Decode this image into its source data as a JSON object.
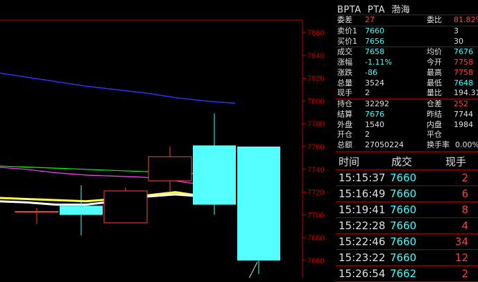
{
  "header": {
    "code": "BPTA",
    "name": "PTA",
    "exchange": "渤海"
  },
  "quote": {
    "weicha_label": "委差",
    "weicha": "27",
    "weibi_label": "委比",
    "weibi": "81.82%",
    "sell1_label": "卖价1",
    "sell1_price": "7660",
    "sell1_vol": "3",
    "buy1_label": "买价1",
    "buy1_price": "7656",
    "buy1_vol": "30",
    "last_label": "成交",
    "last": "7658",
    "avg_label": "均价",
    "avg": "7676",
    "chgpct_label": "涨幅",
    "chgpct": "-1.11%",
    "open_label": "今开",
    "open": "7758",
    "chg_label": "涨跌",
    "chg": "-86",
    "high_label": "最高",
    "high": "7758",
    "vol_label": "总量",
    "vol": "3524",
    "low_label": "最低",
    "low": "7648",
    "curvol_label": "现手",
    "curvol": "2",
    "volratio_label": "量比",
    "volratio": "194.31",
    "oi_label": "持仓",
    "oi": "32292",
    "oichg_label": "仓差",
    "oichg": "252",
    "settle_label": "结算",
    "settle": "7676",
    "presettle_label": "昨结",
    "presettle": "7744",
    "outer_label": "外盘",
    "outer": "1540",
    "inner_label": "内盘",
    "inner": "1984",
    "openpos_label": "开仓",
    "openpos": "2",
    "closepos_label": "平仓",
    "closepos": "",
    "amount_label": "总额",
    "amount": "27050224",
    "turnover_label": "换手率",
    "turnover": "0.00%"
  },
  "ticks": {
    "headers": {
      "time": "时间",
      "price": "成交",
      "vol": "现手"
    },
    "rows": [
      {
        "time": "15:15:37",
        "price": "7660",
        "vol": "2"
      },
      {
        "time": "15:16:49",
        "price": "7660",
        "vol": "6"
      },
      {
        "time": "15:19:41",
        "price": "7660",
        "vol": "8"
      },
      {
        "time": "15:22:28",
        "price": "7660",
        "vol": "4"
      },
      {
        "time": "15:22:46",
        "price": "7660",
        "vol": "34"
      },
      {
        "time": "15:23:22",
        "price": "7660",
        "vol": "12"
      },
      {
        "time": "15:26:54",
        "price": "7662",
        "vol": "2"
      }
    ]
  },
  "chart_data": {
    "type": "candlestick",
    "y_ticks": [
      "7860",
      "7840",
      "7820",
      "7800",
      "7780",
      "7760",
      "7740",
      "7720",
      "7700",
      "7680",
      "7660"
    ],
    "low_label": "7648",
    "colors": {
      "up": "#ff4040",
      "down": "#54ffff",
      "ma1": "#ffffff",
      "ma2": "#ffff40",
      "ma3": "#ff40ff",
      "ma4": "#00ff00",
      "ma5": "#3030ff",
      "axis": "#c00000"
    },
    "candles": [
      {
        "open": 7703,
        "close": 7703,
        "high": 7706,
        "low": 7692
      },
      {
        "open": 7708,
        "close": 7700,
        "high": 7726,
        "low": 7682
      },
      {
        "open": 7693,
        "close": 7721,
        "high": 7724,
        "low": 7693
      },
      {
        "open": 7730,
        "close": 7751,
        "high": 7760,
        "low": 7720
      },
      {
        "open": 7761,
        "close": 7709,
        "high": 7789,
        "low": 7700
      },
      {
        "open": 7760,
        "close": 7660,
        "high": 7760,
        "low": 7648
      }
    ],
    "ma_white": [
      7712,
      7711,
      7709,
      7709,
      7712,
      7716,
      7718,
      7716,
      7712
    ],
    "ma_yellow": [
      7715,
      7714,
      7713,
      7712,
      7714,
      7717,
      7720,
      7716,
      7710
    ],
    "ma_magenta": [
      7742,
      7740,
      7737,
      7735,
      7734,
      7733,
      7730,
      7726,
      7720
    ],
    "ma_green": [
      7743,
      7742,
      7741,
      7740,
      7739,
      7738,
      7737,
      7736,
      7734
    ],
    "ma_blue": [
      7825,
      7821,
      7817,
      7813,
      7810,
      7807,
      7803,
      7800,
      7798
    ]
  }
}
